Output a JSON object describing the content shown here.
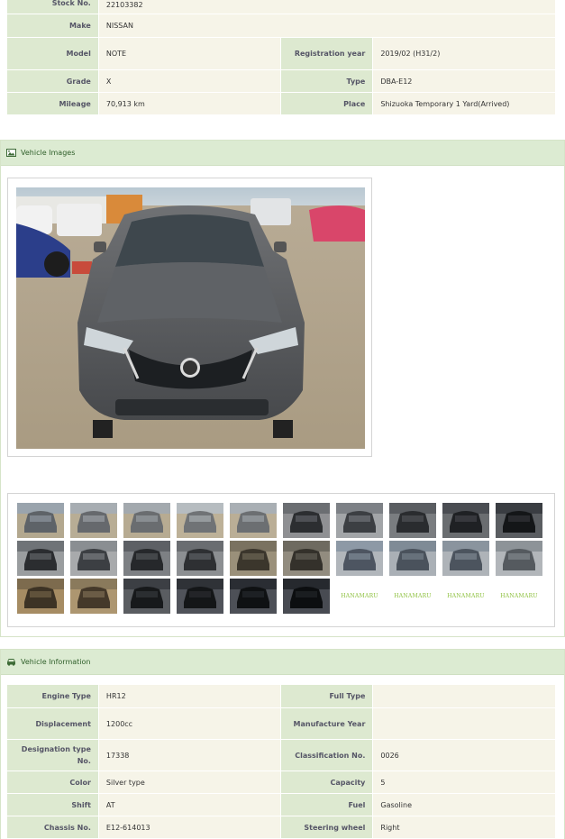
{
  "vehicle_spec": {
    "rows": [
      {
        "label_1": "Stock No.",
        "value_1": "22103382"
      },
      {
        "label_1": "Make",
        "value_1": "NISSAN"
      },
      {
        "label_1": "Model",
        "value_1": "NOTE",
        "label_2": "Registration year",
        "value_2": "2019/02 (H31/2)"
      },
      {
        "label_1": "Grade",
        "value_1": "X",
        "label_2": "Type",
        "value_2": "DBA-E12"
      },
      {
        "label_1": "Mileage",
        "value_1": "70,913 km",
        "label_2": "Place",
        "value_2": "Shizuoka Temporary 1 Yard(Arrived)"
      }
    ]
  },
  "vehicle_images": {
    "title": "Vehicle Images",
    "thumbnail_count": 30,
    "placeholder_logo": "HANAMARU"
  },
  "vehicle_information": {
    "title": "Vehicle Information",
    "rows": [
      {
        "label_1": "Engine Type",
        "value_1": "HR12",
        "label_2": "Full Type",
        "value_2": ""
      },
      {
        "label_1": "Displacement",
        "value_1": "1200cc",
        "label_2": "Manufacture Year",
        "value_2": ""
      },
      {
        "label_1": "Designation type No.",
        "value_1": "17338",
        "label_2": "Classification No.",
        "value_2": "0026"
      },
      {
        "label_1": "Color",
        "value_1": "Silver type",
        "label_2": "Capacity",
        "value_2": "5"
      },
      {
        "label_1": "Shift",
        "value_1": "AT",
        "label_2": "Fuel",
        "value_2": "Gasoline"
      },
      {
        "label_1": "Chassis No.",
        "value_1": "E12-614013",
        "label_2": "Steering wheel",
        "value_2": "Right"
      }
    ]
  },
  "colors": {
    "header_green": "#dcebd2",
    "label_bg": "#dde9d0",
    "value_bg": "#f6f4e8",
    "heading_text": "#2f5f2a"
  }
}
